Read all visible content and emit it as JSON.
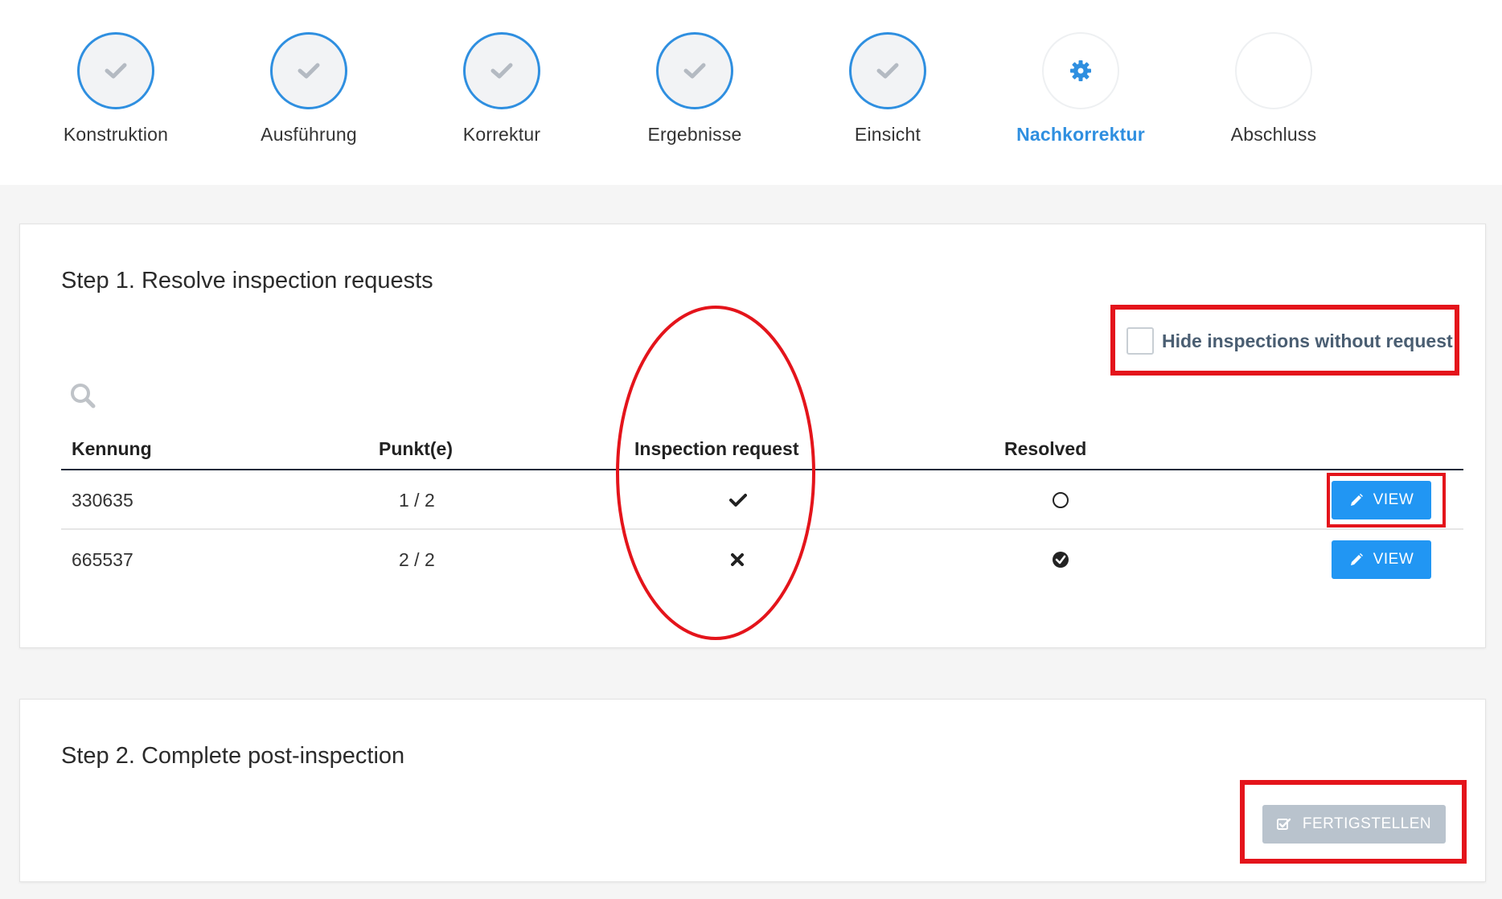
{
  "stepper": {
    "steps": [
      {
        "label": "Konstruktion",
        "state": "done"
      },
      {
        "label": "Ausführung",
        "state": "done"
      },
      {
        "label": "Korrektur",
        "state": "done"
      },
      {
        "label": "Ergebnisse",
        "state": "done"
      },
      {
        "label": "Einsicht",
        "state": "done"
      },
      {
        "label": "Nachkorrektur",
        "state": "current"
      },
      {
        "label": "Abschluss",
        "state": "future"
      }
    ]
  },
  "step1": {
    "title": "Step 1. Resolve inspection requests",
    "hide_label": "Hide inspections without request",
    "hide_checked": false,
    "columns": {
      "id": "Kennung",
      "points": "Punkt(e)",
      "request": "Inspection request",
      "resolved": "Resolved"
    },
    "rows": [
      {
        "id": "330635",
        "points": "1 / 2",
        "request": true,
        "resolved": false,
        "action": "VIEW"
      },
      {
        "id": "665537",
        "points": "2 / 2",
        "request": false,
        "resolved": true,
        "action": "VIEW"
      }
    ]
  },
  "step2": {
    "title": "Step 2. Complete post-inspection",
    "finish_label": "FERTIGSTELLEN"
  },
  "colors": {
    "accent": "#2f8fe0",
    "button": "#2196f3",
    "disabled_button": "#b9c3cd",
    "annotation": "#e4141b"
  }
}
